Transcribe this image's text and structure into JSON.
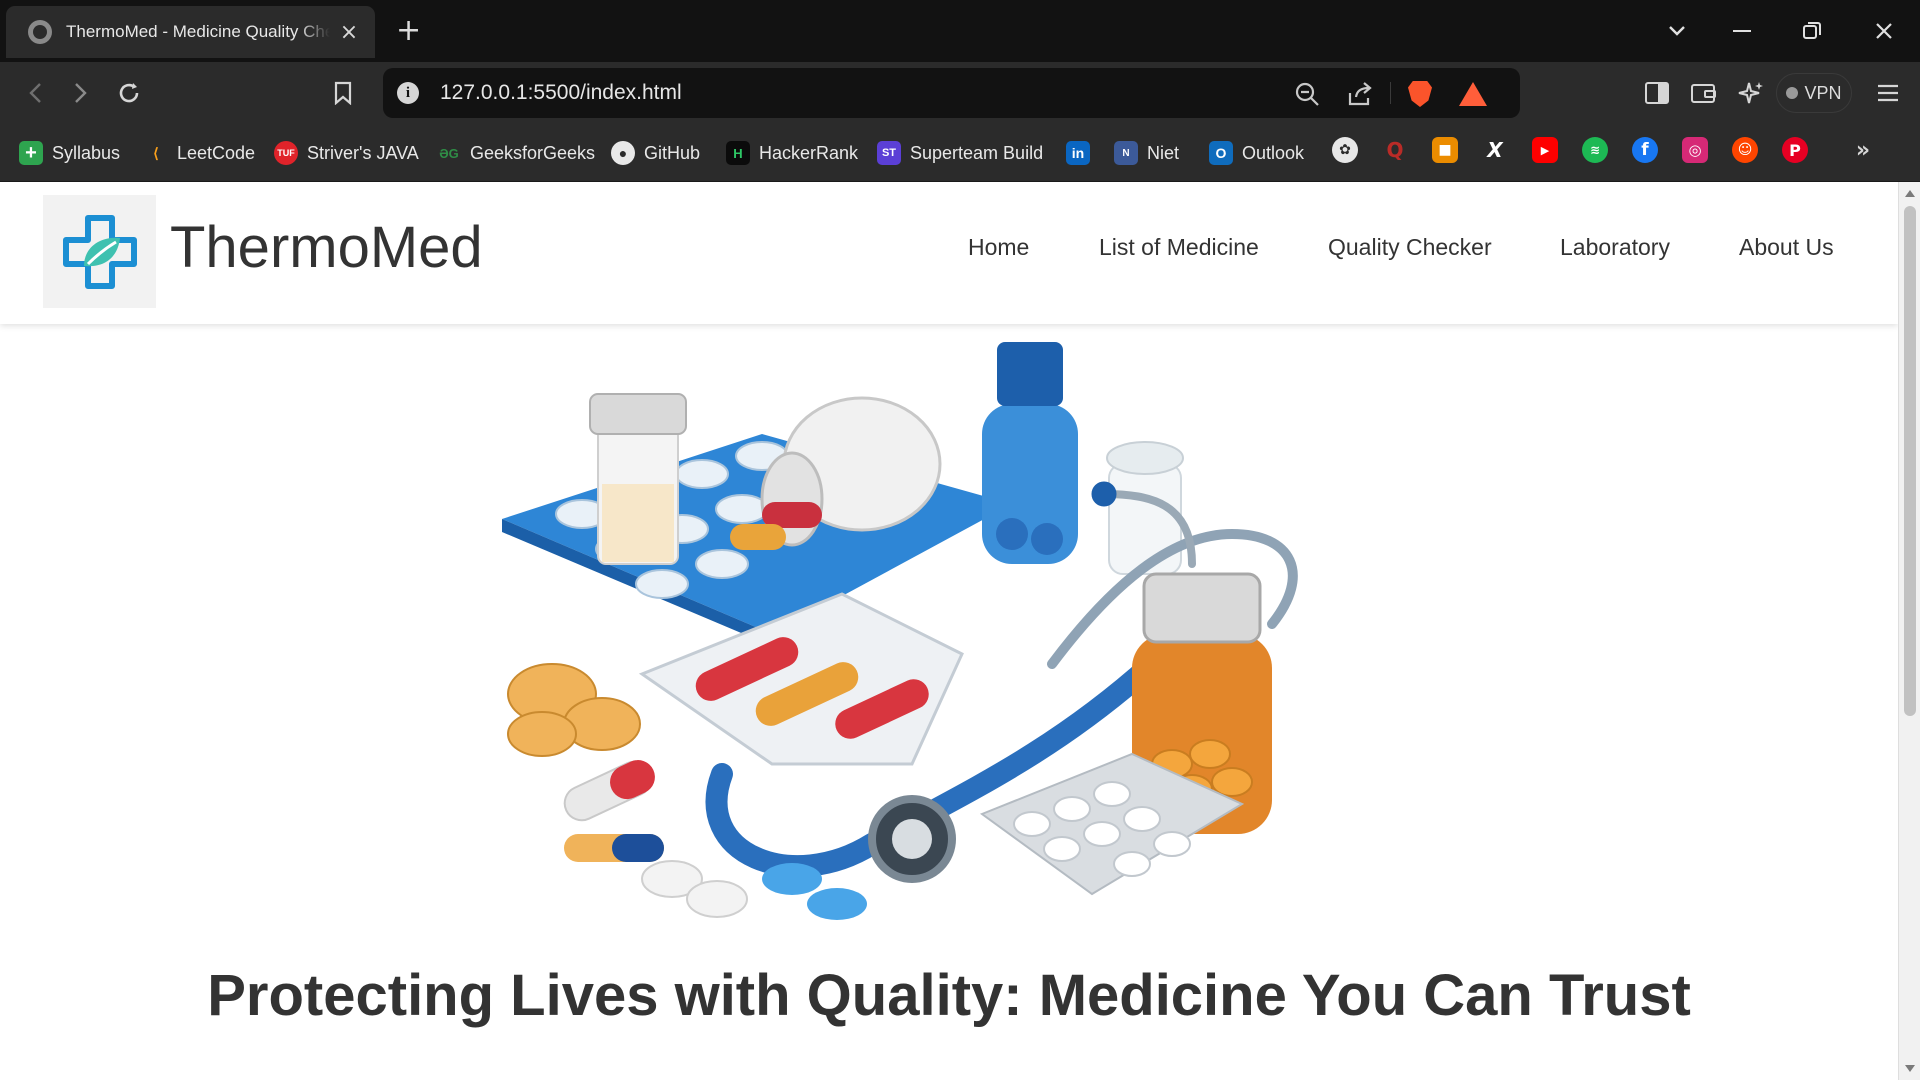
{
  "browser": {
    "tab_title": "ThermoMed - Medicine Quality Checker",
    "tab_close": "×",
    "new_tab": "+",
    "url": "127.0.0.1:5500/index.html",
    "vpn_label": "VPN",
    "window_controls": [
      "chevron-down",
      "minimize",
      "restore",
      "close"
    ]
  },
  "bookmarks": [
    {
      "label": "Syllabus",
      "icon": "green-plus",
      "color": "#2ea44f"
    },
    {
      "label": "LeetCode",
      "icon": "leetcode",
      "color": "#2b2b2b"
    },
    {
      "label": "Striver's JAVA",
      "icon": "tuf",
      "color": "#e0232a"
    },
    {
      "label": "GeeksforGeeks",
      "icon": "gfg",
      "color": "#2b2b2b"
    },
    {
      "label": "GitHub",
      "icon": "github",
      "color": "#2b2b2b"
    },
    {
      "label": "HackerRank",
      "icon": "hackerrank",
      "color": "#0b0b0b"
    },
    {
      "label": "Superteam Build",
      "icon": "superteam",
      "color": "#5b3fd6"
    },
    {
      "label": "",
      "icon": "linkedin",
      "color": "#0a66c2"
    },
    {
      "label": "Niet",
      "icon": "niet",
      "color": "#2b2b2b"
    },
    {
      "label": "Outlook",
      "icon": "outlook",
      "color": "#0f6cbd"
    }
  ],
  "bookmark_icons": [
    {
      "name": "chatgpt",
      "color": "#2b2b2b"
    },
    {
      "name": "quora",
      "color": "#b92b27"
    },
    {
      "name": "office",
      "color": "#eb3c00"
    },
    {
      "name": "x",
      "color": "#2b2b2b"
    },
    {
      "name": "youtube",
      "color": "#ff0000"
    },
    {
      "name": "spotify",
      "color": "#1db954"
    },
    {
      "name": "facebook",
      "color": "#1877f2"
    },
    {
      "name": "instagram",
      "color": "#d62976"
    },
    {
      "name": "reddit",
      "color": "#ff4500"
    },
    {
      "name": "pinterest",
      "color": "#e60023"
    }
  ],
  "site": {
    "brand": "ThermoMed",
    "nav": [
      "Home",
      "List of Medicine",
      "Quality Checker",
      "Laboratory",
      "About Us"
    ],
    "headline": "Protecting Lives with Quality: Medicine You Can Trust",
    "hero_alt": "medicines-and-stethoscope-illustration"
  }
}
